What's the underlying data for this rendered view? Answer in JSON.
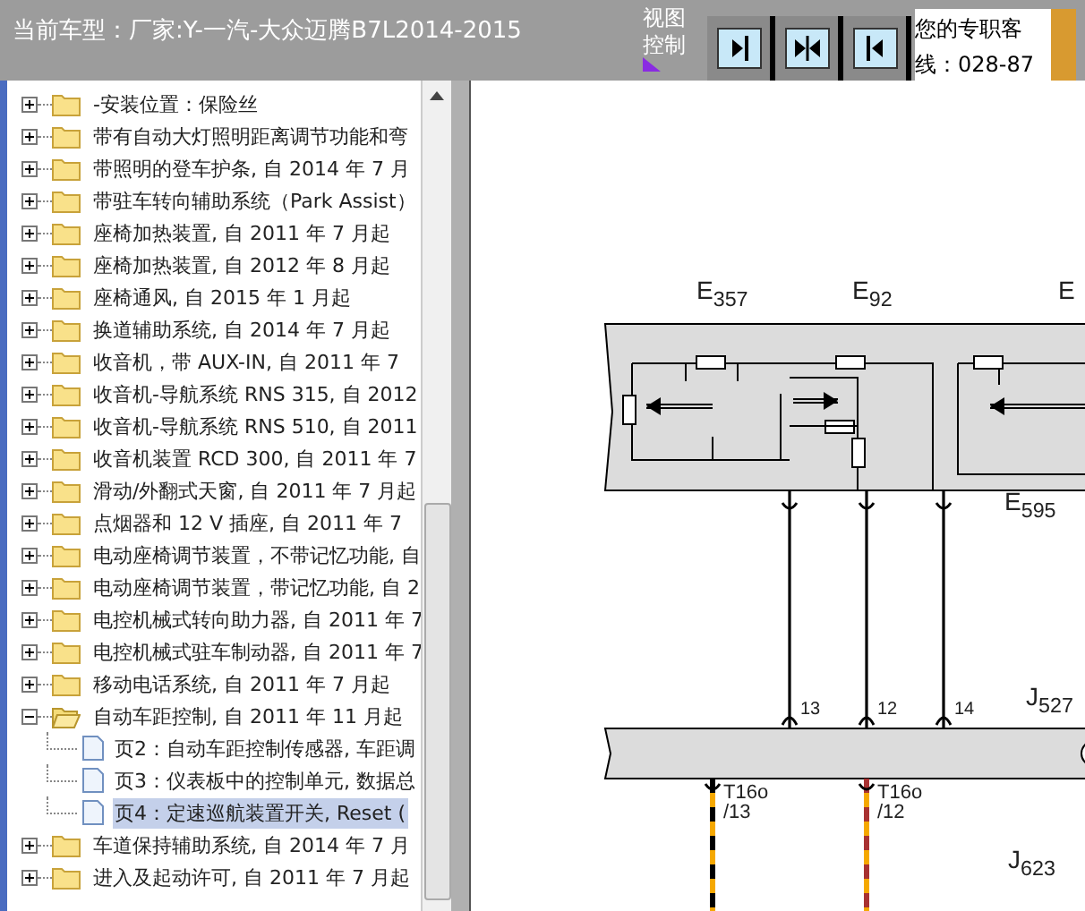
{
  "header": {
    "title": "当前车型：厂家:Y-一汽-大众迈腾B7L2014-2015",
    "view_control_label": "视图控制",
    "view_buttons": [
      {
        "kind": "right"
      },
      {
        "kind": "inward"
      },
      {
        "kind": "left"
      }
    ],
    "contact_lines": [
      "您的专职客",
      "线：028-87"
    ]
  },
  "tree": [
    {
      "label": "-安装位置：保险丝",
      "expanded": false,
      "selected": false
    },
    {
      "label": "带有自动大灯照明距离调节功能和弯",
      "expanded": false,
      "selected": false
    },
    {
      "label": "带照明的登车护条, 自 2014 年 7 月",
      "expanded": false,
      "selected": false
    },
    {
      "label": "带驻车转向辅助系统（Park Assist）",
      "expanded": false,
      "selected": false
    },
    {
      "label": "座椅加热装置, 自 2011 年 7 月起",
      "expanded": false,
      "selected": false
    },
    {
      "label": "座椅加热装置, 自 2012 年 8 月起",
      "expanded": false,
      "selected": false
    },
    {
      "label": "座椅通风, 自 2015 年 1 月起",
      "expanded": false,
      "selected": false
    },
    {
      "label": "换道辅助系统, 自 2014 年 7 月起",
      "expanded": false,
      "selected": false
    },
    {
      "label": "收音机，带 AUX-IN, 自 2011 年 7",
      "expanded": false,
      "selected": false
    },
    {
      "label": "收音机-导航系统 RNS 315, 自 2012",
      "expanded": false,
      "selected": false
    },
    {
      "label": "收音机-导航系统 RNS 510, 自 2011",
      "expanded": false,
      "selected": false
    },
    {
      "label": "收音机装置 RCD 300, 自 2011 年 7",
      "expanded": false,
      "selected": false
    },
    {
      "label": "滑动/外翻式天窗, 自 2011 年 7 月起",
      "expanded": false,
      "selected": false
    },
    {
      "label": "点烟器和 12 V 插座, 自 2011 年 7",
      "expanded": false,
      "selected": false
    },
    {
      "label": "电动座椅调节装置，不带记忆功能, 自",
      "expanded": false,
      "selected": false
    },
    {
      "label": "电动座椅调节装置，带记忆功能, 自 2",
      "expanded": false,
      "selected": false
    },
    {
      "label": "电控机械式转向助力器, 自 2011 年 7",
      "expanded": false,
      "selected": false
    },
    {
      "label": "电控机械式驻车制动器, 自 2011 年 7",
      "expanded": false,
      "selected": false
    },
    {
      "label": "移动电话系统, 自 2011 年 7 月起",
      "expanded": false,
      "selected": false
    },
    {
      "label": "自动车距控制, 自 2011 年 11 月起",
      "expanded": true,
      "selected": false,
      "children": [
        {
          "label": "页2：自动车距控制传感器, 车距调",
          "selected": false
        },
        {
          "label": "页3：仪表板中的控制单元, 数据总",
          "selected": false
        },
        {
          "label": "页4：定速巡航装置开关, Reset (",
          "selected": true
        }
      ]
    },
    {
      "label": "车道保持辅助系统, 自 2014 年 7 月",
      "expanded": false,
      "selected": false
    },
    {
      "label": "进入及起动许可, 自 2011 年 7 月起",
      "expanded": false,
      "selected": false
    }
  ],
  "diagram": {
    "labels": [
      "E$_{357}$",
      "E$_{92}$",
      "E",
      "E$_{595}$",
      "13",
      "12",
      "14",
      "J$_{527}$",
      "T16o",
      "/13",
      "T16o",
      "/12",
      "J$_{623}$"
    ]
  }
}
